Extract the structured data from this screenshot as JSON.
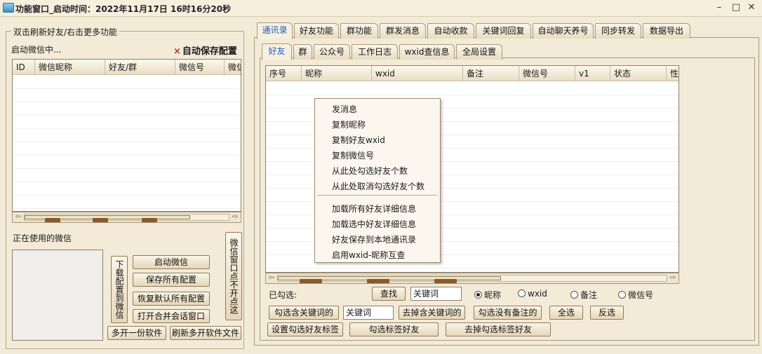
{
  "window": {
    "title": "功能窗口_启动时间：2022年11月17日 16时16分20秒",
    "minimize": "–",
    "maximize": "□",
    "close": "✕"
  },
  "left": {
    "group_label": "双击刷新好友/右击更多功能",
    "status": "启动微信中...",
    "auto_save_mark": "×",
    "auto_save": "自动保存配置",
    "columns": [
      "ID",
      "微信昵称",
      "好友/群",
      "微信号",
      "微信"
    ],
    "in_use_label": "正在使用的微信",
    "buttons": {
      "download_cloud": "下载配置到微信",
      "start_wechat": "启动微信",
      "save_all": "保存所有配置",
      "restore_default": "恢复默认所有配置",
      "open_merge": "打开合并会话窗口",
      "no_click": "微信窗口点不开点这",
      "multi_open": "多开一份软件",
      "refresh_multi": "刷新多开软件文件"
    }
  },
  "tabs": [
    "通讯录",
    "好友功能",
    "群功能",
    "群发消息",
    "自动收款",
    "关键词回复",
    "自动聊天养号",
    "同步转发",
    "数据导出"
  ],
  "active_tab": 0,
  "subtabs": [
    "好友",
    "群",
    "公众号",
    "工作日志",
    "wxid查信息",
    "全局设置"
  ],
  "active_subtab": 0,
  "friends_table": {
    "columns": [
      "序号",
      "昵称",
      "wxid",
      "备注",
      "微信号",
      "v1",
      "状态",
      "性"
    ]
  },
  "context_menu": {
    "group1": [
      "发消息",
      "复制昵称",
      "复制好友wxid",
      "复制微信号",
      "从此处勾选好友个数",
      "从此处取消勾选好友个数"
    ],
    "group2": [
      "加载所有好友详细信息",
      "加载选中好友详细信息",
      "好友保存到本地通讯录",
      "启用wxid-昵称互查"
    ]
  },
  "search": {
    "checked_label": "已勾选:",
    "find_button": "查找",
    "keyword_value": "关键词",
    "radios": [
      "昵称",
      "wxid",
      "备注",
      "微信号"
    ],
    "selected_radio": 0
  },
  "actions": {
    "select_with_keyword": "勾选含关键词的",
    "keyword_value": "关键词",
    "deselect_with_keyword": "去掉含关键词的",
    "select_no_remark": "勾选没有备注的",
    "select_all": "全选",
    "invert": "反选",
    "set_tag": "设置勾选好友标签",
    "select_tagged": "勾选标签好友",
    "deselect_tagged": "去掉勾选标签好友"
  }
}
